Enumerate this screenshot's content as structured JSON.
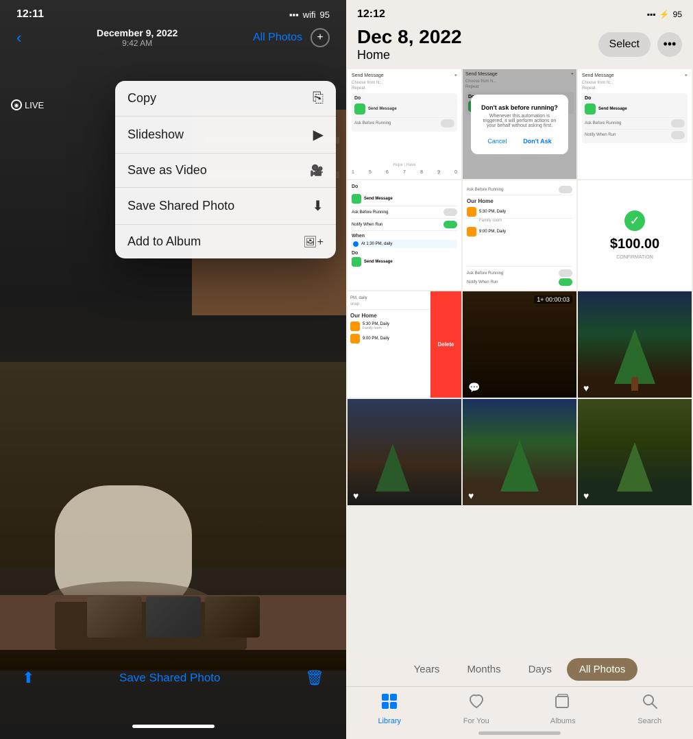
{
  "left": {
    "status": {
      "time": "12:11",
      "signal": "▪▪▪",
      "wifi": "WiFi",
      "battery": "95"
    },
    "nav": {
      "back_label": "‹",
      "date": "December 9, 2022",
      "time": "9:42 AM",
      "all_photos": "All Photos",
      "plus": "+"
    },
    "live_label": "LIVE",
    "context_menu": {
      "items": [
        {
          "label": "Copy",
          "icon": "⎘"
        },
        {
          "label": "Slideshow",
          "icon": "▶"
        },
        {
          "label": "Save as Video",
          "icon": "⬛"
        },
        {
          "label": "Save Shared Photo",
          "icon": "⬇"
        },
        {
          "label": "Add to Album",
          "icon": "⊕"
        }
      ]
    },
    "bottom_bar": {
      "share_label": "Save Shared Photo",
      "share_icon": "⬆",
      "trash_icon": "🗑"
    },
    "home_indicator": ""
  },
  "right": {
    "status": {
      "time": "12:12",
      "battery": "95"
    },
    "nav": {
      "date": "Dec 8, 2022",
      "location": "Home",
      "select_label": "Select",
      "more_icon": "•••"
    },
    "time_filters": [
      "Years",
      "Months",
      "Days",
      "All Photos"
    ],
    "active_filter": "All Photos",
    "tabs": [
      {
        "label": "Library",
        "icon": "🖼",
        "active": true
      },
      {
        "label": "For You",
        "icon": "♡",
        "active": false
      },
      {
        "label": "Albums",
        "icon": "📁",
        "active": false
      },
      {
        "label": "Search",
        "icon": "🔍",
        "active": false
      }
    ]
  }
}
